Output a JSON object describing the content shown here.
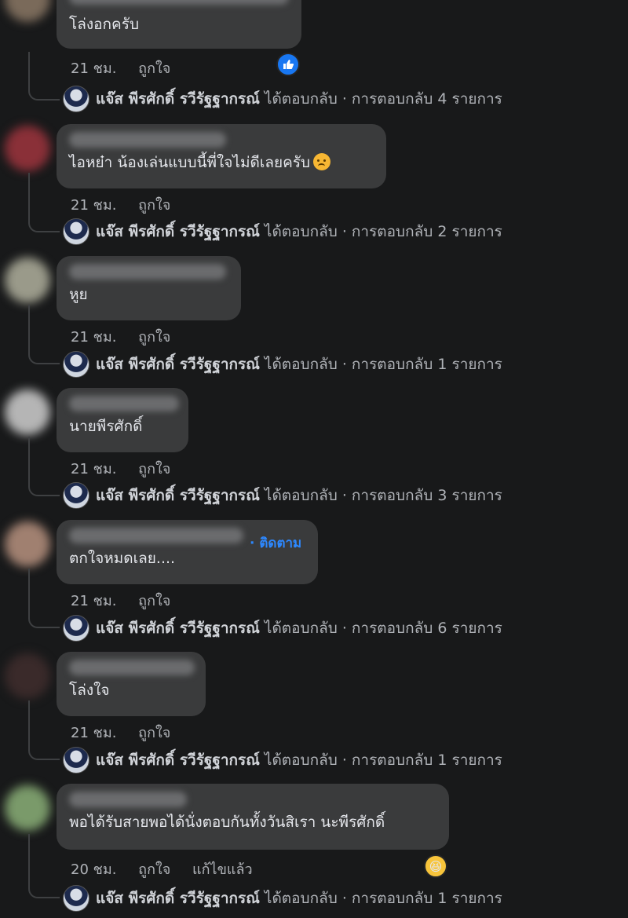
{
  "meta_labels": {
    "like": "ถูกใจ",
    "edited": "แก้ไขแล้ว"
  },
  "reply_author": "แจ๊ส พีรศักดิ์ รวีรัฐฐากรณ์",
  "comments": [
    {
      "text": "โล่งอกครับ",
      "time": "21 ชม.",
      "reply_summary": "ได้ตอบกลับ · การตอบกลับ 4 รายการ",
      "reaction": "like"
    },
    {
      "text": "ไอหย๋า น้องเล่นแบบนี้พี่ใจไม่ดีเลยครับ",
      "time": "21 ชม.",
      "reply_summary": "ได้ตอบกลับ · การตอบกลับ 2 รายการ",
      "inline_emoji": "sad"
    },
    {
      "text": "หูย",
      "time": "21 ชม.",
      "reply_summary": "ได้ตอบกลับ · การตอบกลับ 1 รายการ"
    },
    {
      "text": "นายพีรศักดิ์",
      "time": "21 ชม.",
      "reply_summary": "ได้ตอบกลับ · การตอบกลับ 3 รายการ"
    },
    {
      "text": "ตกใจหมดเลย....",
      "time": "21 ชม.",
      "follow": "· ติดตาม",
      "reply_summary": "ได้ตอบกลับ · การตอบกลับ 6 รายการ"
    },
    {
      "text": "โล่งใจ",
      "time": "21 ชม.",
      "reply_summary": "ได้ตอบกลับ · การตอบกลับ 1 รายการ"
    },
    {
      "text": "พอได้รับสายพอได้นั่งตอบกันทั้งวันสิเรา นะพีรศักดิ์",
      "time": "20 ชม.",
      "edited": true,
      "reply_summary": "ได้ตอบกลับ · การตอบกลับ 1 รายการ",
      "reaction": "haha"
    }
  ],
  "colors": {
    "background": "#18191a",
    "bubble": "#3a3b3c",
    "link_blue": "#2d88ff",
    "like_blue": "#1877f2",
    "muted_text": "#b0b3b8"
  }
}
